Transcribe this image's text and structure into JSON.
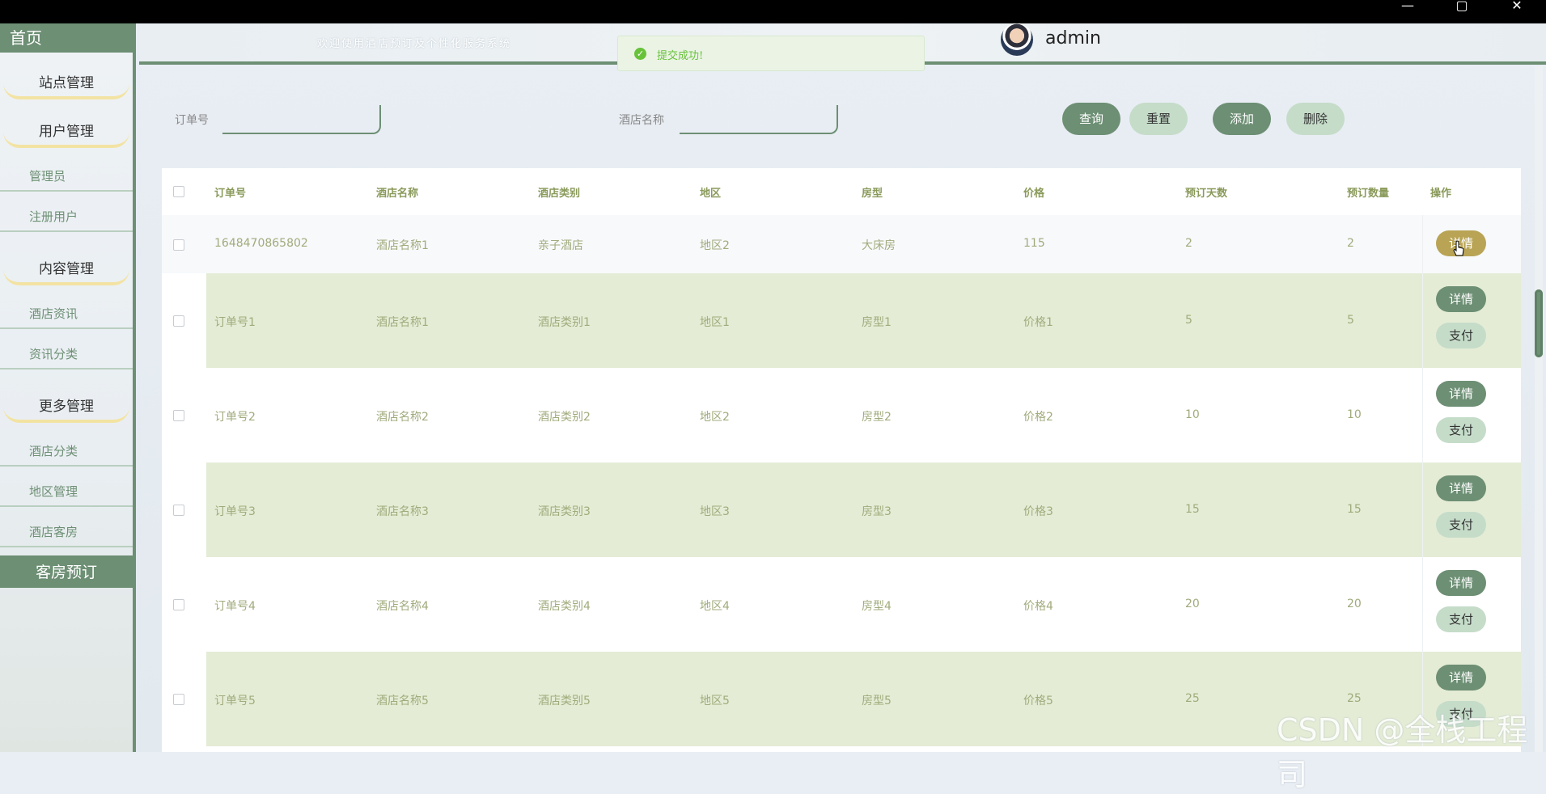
{
  "sidebar": {
    "home": "首页",
    "groups": [
      {
        "label": "站点管理"
      },
      {
        "label": "用户管理",
        "items": [
          "管理员",
          "注册用户"
        ]
      },
      {
        "label": "内容管理",
        "items": [
          "酒店资讯",
          "资讯分类"
        ]
      },
      {
        "label": "更多管理",
        "items": [
          "酒店分类",
          "地区管理",
          "酒店客房"
        ]
      }
    ],
    "active": "客房预订"
  },
  "header": {
    "welcome": "欢迎使用酒店预订及个性化服务系统",
    "username": "admin"
  },
  "toast": {
    "text": "提交成功!"
  },
  "search": {
    "order_label": "订单号",
    "order_value": "",
    "hotel_label": "酒店名称",
    "hotel_value": "",
    "query": "查询",
    "reset": "重置",
    "add": "添加",
    "delete": "删除"
  },
  "table": {
    "columns": [
      "订单号",
      "酒店名称",
      "酒店类别",
      "地区",
      "房型",
      "价格",
      "预订天数",
      "预订数量",
      "操作"
    ],
    "rows": [
      {
        "order": "1648470865802",
        "hotel": "酒店名称1",
        "category": "亲子酒店",
        "region": "地区2",
        "room": "大床房",
        "price": "115",
        "days": "2",
        "qty": "2",
        "actions": [
          "详情"
        ]
      },
      {
        "order": "订单号1",
        "hotel": "酒店名称1",
        "category": "酒店类别1",
        "region": "地区1",
        "room": "房型1",
        "price": "价格1",
        "days": "5",
        "qty": "5",
        "actions": [
          "详情",
          "支付"
        ]
      },
      {
        "order": "订单号2",
        "hotel": "酒店名称2",
        "category": "酒店类别2",
        "region": "地区2",
        "room": "房型2",
        "price": "价格2",
        "days": "10",
        "qty": "10",
        "actions": [
          "详情",
          "支付"
        ]
      },
      {
        "order": "订单号3",
        "hotel": "酒店名称3",
        "category": "酒店类别3",
        "region": "地区3",
        "room": "房型3",
        "price": "价格3",
        "days": "15",
        "qty": "15",
        "actions": [
          "详情",
          "支付"
        ]
      },
      {
        "order": "订单号4",
        "hotel": "酒店名称4",
        "category": "酒店类别4",
        "region": "地区4",
        "room": "房型4",
        "price": "价格4",
        "days": "20",
        "qty": "20",
        "actions": [
          "详情",
          "支付"
        ]
      },
      {
        "order": "订单号5",
        "hotel": "酒店名称5",
        "category": "酒店类别5",
        "region": "地区5",
        "room": "房型5",
        "price": "价格5",
        "days": "25",
        "qty": "25",
        "actions": [
          "详情",
          "支付"
        ]
      }
    ]
  },
  "watermark": "CSDN @全栈工程司",
  "colors": {
    "primary": "#6d8f74",
    "light": "#c5dcc9",
    "row_alt": "#e4ecd5",
    "text": "#a0ab7c",
    "success": "#67c23a"
  }
}
